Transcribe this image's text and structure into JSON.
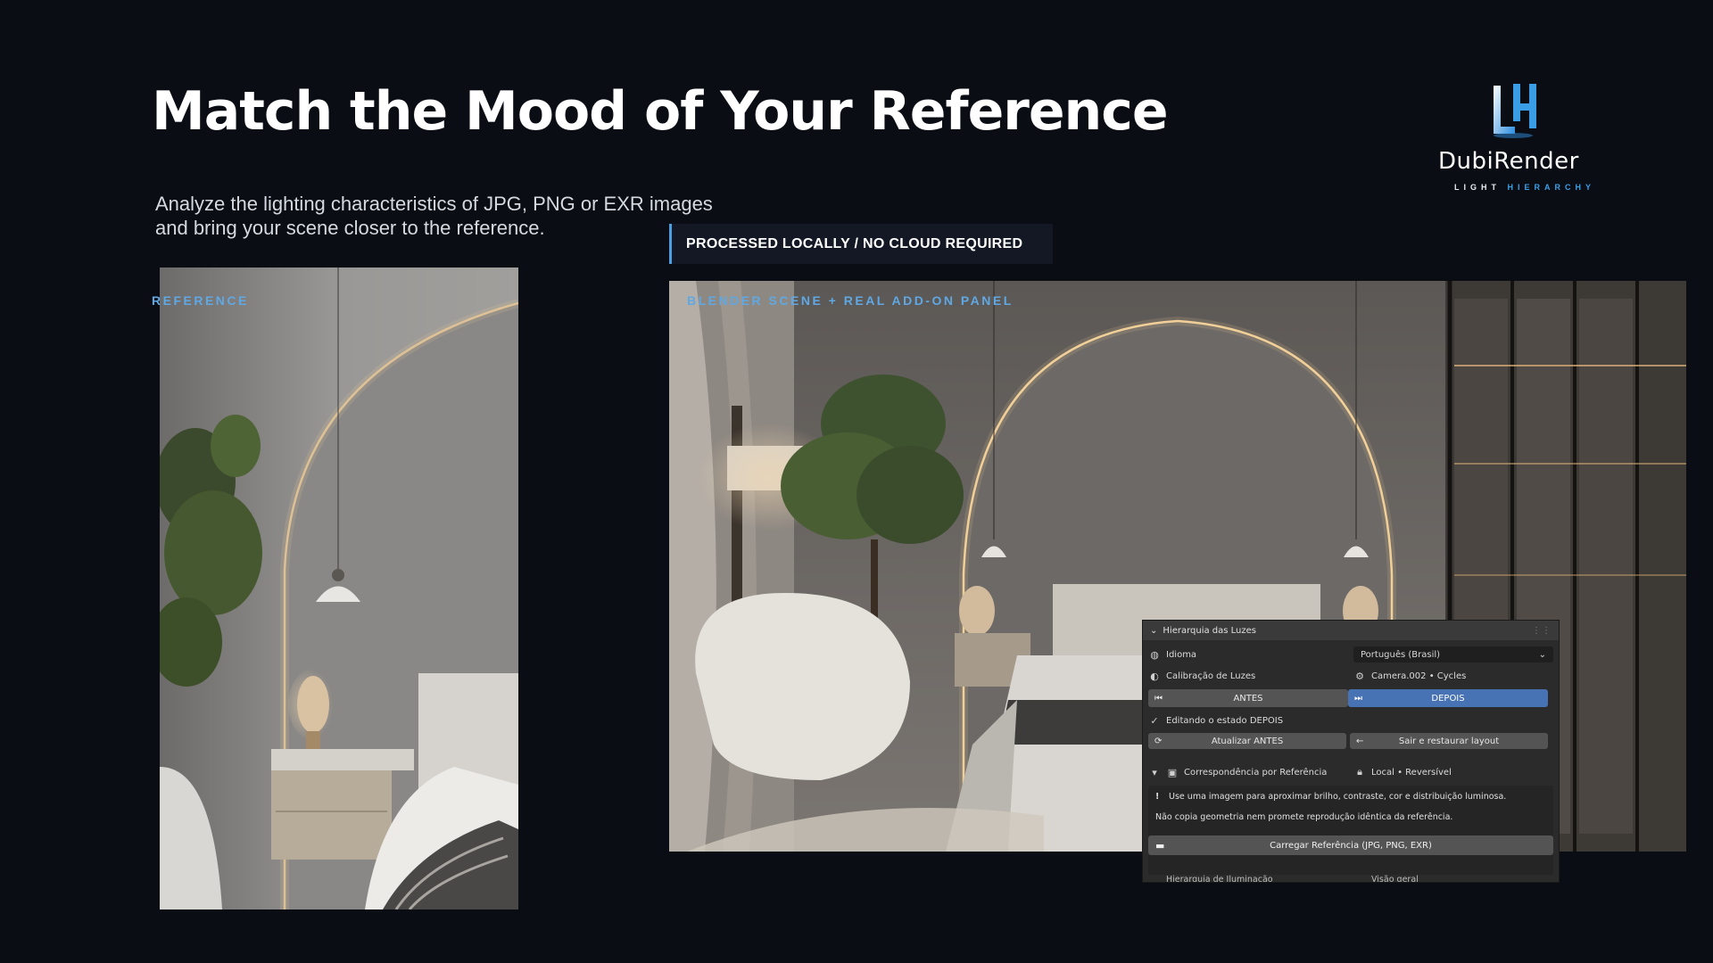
{
  "header": {
    "title": "Match the Mood of Your Reference",
    "subtitle_line1": "Analyze the lighting characteristics of JPG, PNG or EXR images",
    "subtitle_line2": "and bring your scene closer to the reference."
  },
  "logo": {
    "mark": "LH",
    "name": "DubiRender",
    "tagline_part1": "LIGHT ",
    "tagline_part2": "HIERARCHY"
  },
  "badge": {
    "text": "PROCESSED LOCALLY  /  NO CLOUD REQUIRED"
  },
  "labels": {
    "reference": "REFERENCE",
    "scene": "BLENDER SCENE + REAL ADD-ON PANEL"
  },
  "panel": {
    "title": "Hierarquia das Luzes",
    "language_label": "Idioma",
    "language_value": "Português (Brasil)",
    "calibration_label": "Calibração de Luzes",
    "camera_value": "Camera.002 • Cycles",
    "before_label": "ANTES",
    "after_label": "DEPOIS",
    "editing_state": "Editando o estado DEPOIS",
    "update_before": "Atualizar ANTES",
    "exit_restore": "Sair e restaurar layout",
    "match_section": "Correspondência por Referência",
    "local_reversible": "Local • Reversível",
    "info_line1": "Use uma imagem para aproximar brilho, contraste, cor e distribuição luminosa.",
    "info_line2": "Não copia geometria nem promete reprodução idêntica da referência.",
    "load_reference": "Carregar Referência (JPG, PNG, EXR)",
    "cut_left": "Hierarquia de Iluminação",
    "cut_right": "Visão geral"
  },
  "colors": {
    "background": "#0a0d14",
    "accent": "#4a9fe2",
    "panel_active": "#4772b3"
  }
}
